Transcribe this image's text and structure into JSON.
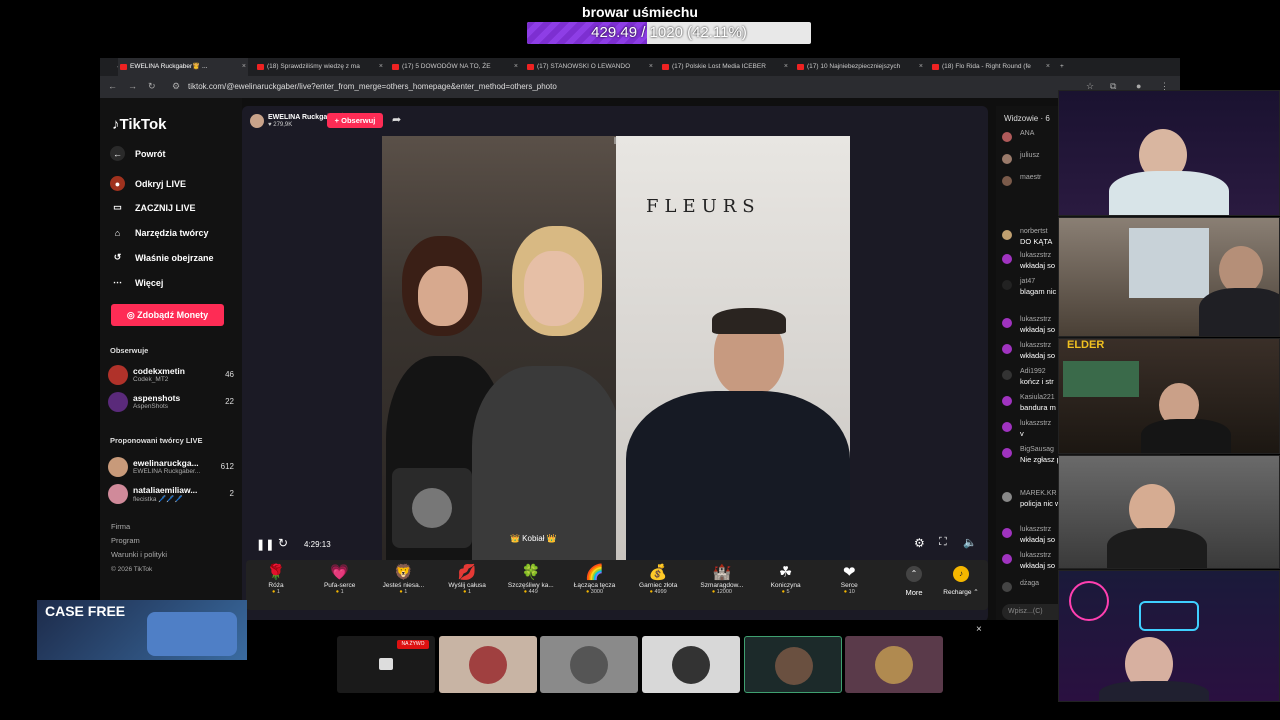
{
  "overlay": {
    "title": "browar uśmiechu",
    "progress_text": "429.49 / 1020 (42.11%)",
    "progress_fraction": 0.4211,
    "fill_color": "#7d2fd1"
  },
  "browser": {
    "tabs": [
      "EWELINA Ruckgaber👸 ...",
      "(18) Sprawdziliśmy wiedzę z ma",
      "(17) 5 DOWODÓW NA TO, ŻE ",
      "(17) STANOWSKI O LEWANDO",
      "(17) Polskie Lost Media ICEBER",
      "(17) 10 Najniebezpieczniejszych",
      "(18) Flo Rida - Right Round (fe"
    ],
    "url": "tiktok.com/@ewelinaruckgaber/live?enter_from_merge=others_homepage&enter_method=others_photo"
  },
  "sidebar": {
    "logo": "TikTok",
    "nav": [
      {
        "label": "Powrót",
        "icon": "back-arrow-icon",
        "glyph": "←"
      },
      {
        "label": "Odkryj LIVE",
        "icon": "live-explore-icon",
        "glyph": "●"
      },
      {
        "label": "ZACZNIJ LIVE",
        "icon": "camera-icon",
        "glyph": "▭"
      },
      {
        "label": "Narzędzia twórcy",
        "icon": "home-tools-icon",
        "glyph": "⌂"
      },
      {
        "label": "Właśnie obejrzane",
        "icon": "history-icon",
        "glyph": "↺"
      },
      {
        "label": "Więcej",
        "icon": "more-dots-icon",
        "glyph": "⋯"
      }
    ],
    "coins_button": "Zdobądź Monety",
    "following_title": "Obserwuje",
    "following": [
      {
        "name": "codekxmetin",
        "sub": "Codek_MT2",
        "count": "46"
      },
      {
        "name": "aspenshots",
        "sub": "AspenShots",
        "count": "22"
      }
    ],
    "suggested_title": "Proponowani twórcy LIVE",
    "suggested": [
      {
        "name": "ewelinaruckga...",
        "sub": "EWELINA Ruckgaber...",
        "count": "612"
      },
      {
        "name": "nataliaemiliaw...",
        "sub": "flecistka 🖊️🖊️🖊️",
        "count": "2"
      }
    ],
    "footer": [
      "Firma",
      "Program",
      "Warunki i polityki",
      "© 2026 TikTok"
    ]
  },
  "live": {
    "host_name": "EWELINA Ruckgaber👸 –",
    "host_likes": "♥ 279,9K",
    "follow_button": "+ Obserwuj",
    "poster_text": "FLEURS",
    "guest_label": "👑 Kobiał 👑",
    "timer": "4:29:13"
  },
  "gifts": [
    {
      "name": "Róża",
      "price": "1",
      "icon": "🌹"
    },
    {
      "name": "Pufa-serce",
      "price": "1",
      "icon": "💗"
    },
    {
      "name": "Jesteś niesa...",
      "price": "1",
      "icon": "🦁"
    },
    {
      "name": "Wyślij całusa",
      "price": "1",
      "icon": "💋"
    },
    {
      "name": "Szczęśliwy ka...",
      "price": "449",
      "icon": "🍀"
    },
    {
      "name": "Łącząca tęcza",
      "price": "3000",
      "icon": "🌈"
    },
    {
      "name": "Garniec złota",
      "price": "4999",
      "icon": "💰"
    },
    {
      "name": "Szmaragdow...",
      "price": "12000",
      "icon": "🏰"
    },
    {
      "name": "Koniczyna",
      "price": "5",
      "icon": "☘"
    },
    {
      "name": "Serce",
      "price": "10",
      "icon": "❤"
    }
  ],
  "gifts_more": "More",
  "recharge": "Recharge ⌃",
  "chat": {
    "title": "Widzowie · 6",
    "messages": [
      {
        "user": "ANA",
        "text": "",
        "color": "#b05a5a"
      },
      {
        "user": "juliusz",
        "text": "",
        "color": "#9a7a6a"
      },
      {
        "user": "maestr",
        "text": "",
        "color": "#7a5a4a"
      },
      {
        "user": "norbertst",
        "text": "DO KĄTA",
        "color": "#c0a070"
      },
      {
        "user": "lukaszstrz",
        "text": "wkładaj so",
        "color": "#a033c0"
      },
      {
        "user": "jat47",
        "text": "blagam nic kamisariat",
        "color": "#222222"
      },
      {
        "user": "lukaszstrz",
        "text": "wkładaj so",
        "color": "#a033c0"
      },
      {
        "user": "lukaszstrz",
        "text": "wkładaj so",
        "color": "#a033c0"
      },
      {
        "user": "Adi1992",
        "text": "kończ i str",
        "color": "#333333"
      },
      {
        "user": "Kasiula221",
        "text": "bandura m",
        "color": "#a033c0"
      },
      {
        "user": "lukaszstrz",
        "text": "v",
        "color": "#a033c0"
      },
      {
        "user": "BigSausag",
        "text": "Nie zgłasz przeprasza nawet zerw",
        "color": "#a033c0"
      },
      {
        "user": "MAREK.KR",
        "text": "policja nic walcze z h",
        "color": "#888888"
      },
      {
        "user": "lukaszstrz",
        "text": "wkładaj so",
        "color": "#a033c0"
      },
      {
        "user": "lukaszstrz",
        "text": "wkładaj so",
        "color": "#a033c0"
      },
      {
        "user": "dżaga",
        "text": "",
        "color": "#444444"
      }
    ],
    "input_placeholder": "Wpisz...(C)"
  },
  "cam_label": "ELDER",
  "bottom_strip": {
    "live_badge": "NA ŻYWO"
  },
  "promo": {
    "text": "CASE FREE"
  },
  "close_icon": "×"
}
